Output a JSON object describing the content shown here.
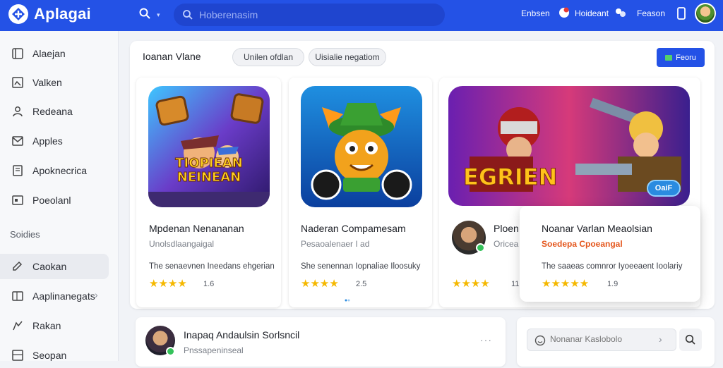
{
  "app": {
    "name": "Aplagai",
    "brand_color": "#2452e6"
  },
  "topbar": {
    "search_placeholder": "Hoberenasim",
    "links": [
      {
        "label": "Enbsen",
        "icon": ""
      },
      {
        "label": "Hoideant",
        "icon": "notification-icon"
      },
      {
        "label": "Feason",
        "icon": "settings-icon"
      }
    ]
  },
  "sidebar": {
    "items": [
      {
        "label": "Alaejan",
        "icon": "window-icon"
      },
      {
        "label": "Valken",
        "icon": "image-icon"
      },
      {
        "label": "Redeana",
        "icon": "user-icon"
      },
      {
        "label": "Apples",
        "icon": "mail-icon"
      },
      {
        "label": "Apoknecrica",
        "icon": "document-icon"
      },
      {
        "label": "Poeolanl",
        "icon": "box-icon"
      }
    ],
    "section_label": "Soidies",
    "items2": [
      {
        "label": "Caokan",
        "icon": "edit-icon",
        "active": true
      },
      {
        "label": "Aaplinanegats",
        "icon": "folder-icon",
        "has_chevron": true
      },
      {
        "label": "Rakan",
        "icon": "pin-icon"
      },
      {
        "label": "Seopan",
        "icon": "grid-icon"
      }
    ]
  },
  "panel": {
    "title": "Ioanan Vlane",
    "chips": [
      "Unilen ofdlan",
      "Uisialie negatiom"
    ],
    "button_label": "Feoru"
  },
  "cards": [
    {
      "art_title": "TIOPIEAN NEINEAN",
      "title": "Mpdenan Nenananan",
      "subtitle": "Unolsdlaangaigal",
      "desc": "The senaevnen Ineedans ehgerian",
      "stars": "★★★★",
      "rating": "1.6"
    },
    {
      "title": "Naderan Compamesam",
      "subtitle": "Pesaoalenaer I ad",
      "desc": "She senennan Iopnaliae Iloosuky",
      "stars": "★★★★",
      "rating": "2.5"
    },
    {
      "art_title": "EGRIEN",
      "title": "Ploen",
      "subtitle": "Oricea",
      "stars": "★★★★",
      "rating": "11",
      "badge": "OaiF"
    }
  ],
  "floating_card": {
    "title": "Noanar Varlan Meaolsian",
    "subtitle": "Soedepa Cpoeangal",
    "desc": "The saaeas comnror Iyoeeaent Ioolariy",
    "stars": "★★★★★",
    "rating": "1.9"
  },
  "bottom": {
    "title": "Inapaq Andaulsin Sorlsncil",
    "subtitle": "Pnssapeninseal",
    "search_placeholder": "Nonanar Kaslobolo"
  }
}
